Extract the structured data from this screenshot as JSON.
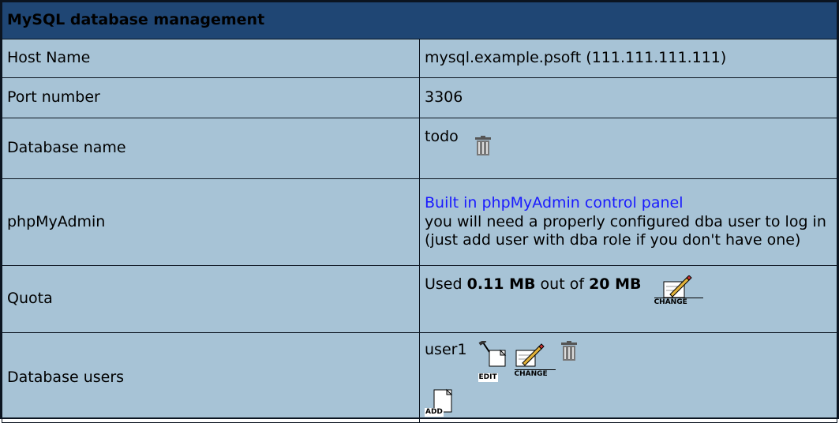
{
  "title": "MySQL database management",
  "rows": {
    "host": {
      "label": "Host Name",
      "value": "mysql.example.psoft (111.111.111.111)"
    },
    "port": {
      "label": "Port number",
      "value": "3306"
    },
    "database": {
      "label": "Database name",
      "value": "todo",
      "delete_icon": "trash-icon"
    },
    "phpmyadmin": {
      "label": "phpMyAdmin",
      "link_text": "Built in phpMyAdmin control panel",
      "note": "you will need a properly configured dba user to log in (just add user with dba role if you don't have one)"
    },
    "quota": {
      "label": "Quota",
      "prefix": "Used ",
      "used": "0.11 MB",
      "middle": " out of ",
      "total": "20 MB",
      "change_caption": "CHANGE"
    },
    "users": {
      "label": "Database users",
      "items": [
        {
          "name": "user1",
          "edit_caption": "EDIT",
          "change_caption": "CHANGE"
        }
      ],
      "add_caption": "ADD"
    }
  },
  "colors": {
    "header_bg": "#1f4674",
    "panel_bg": "#a7c3d6",
    "link": "#1a1aff"
  }
}
